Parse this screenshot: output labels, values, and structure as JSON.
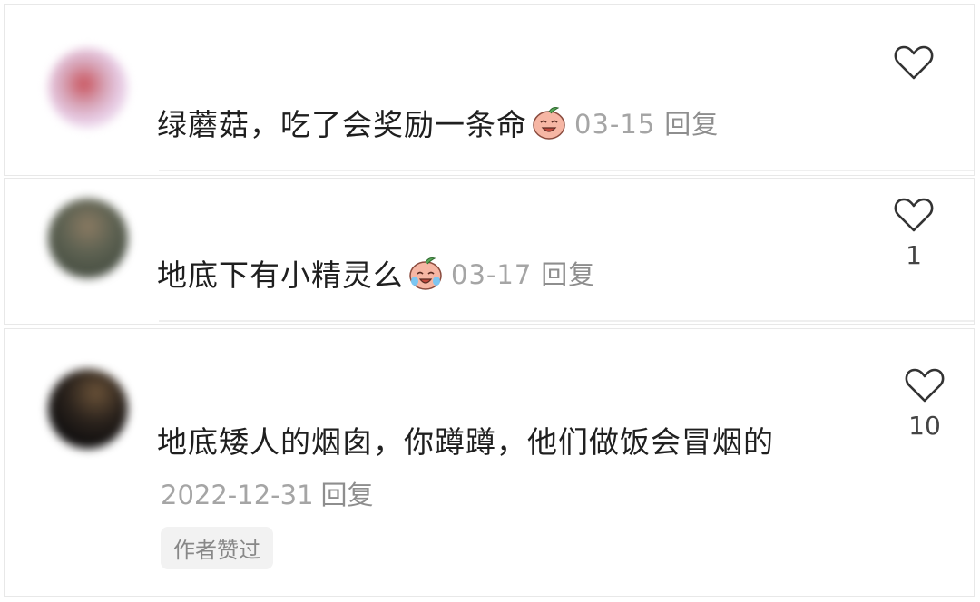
{
  "comments": [
    {
      "text": "绿蘑菇，吃了会奖励一条命",
      "sticker": "laughing-peach-sticker",
      "date": "03-15",
      "reply": "回复",
      "likes": ""
    },
    {
      "text": "地底下有小精灵么",
      "sticker": "crying-peach-sticker",
      "date": "03-17",
      "reply": "回复",
      "likes": "1"
    },
    {
      "text": "地底矮人的烟囱，你蹲蹲，他们做饭会冒烟的",
      "date": "2022-12-31",
      "reply": "回复",
      "likes": "10",
      "badge": "作者赞过"
    }
  ],
  "colors": {
    "text": "#1f1f1f",
    "meta": "#a5a5a5",
    "heart": "#333333",
    "badge_bg": "#f2f2f2"
  },
  "icons": [
    "heart-outline-icon"
  ]
}
